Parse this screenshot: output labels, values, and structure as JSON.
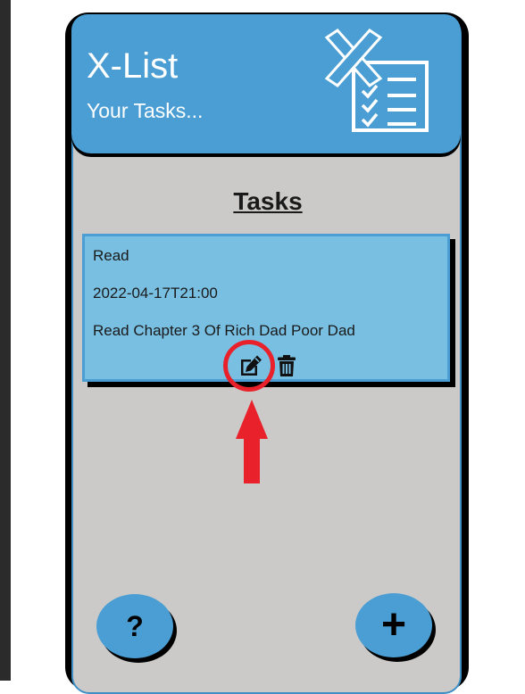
{
  "app": {
    "title": "X-List",
    "subtitle": "Your Tasks..."
  },
  "section": {
    "title": "Tasks"
  },
  "tasks": [
    {
      "title": "Read",
      "date": "2022-04-17T21:00",
      "description": "Read Chapter 3 Of Rich Dad Poor Dad"
    }
  ],
  "buttons": {
    "help_label": "?",
    "add_label": "+"
  },
  "icons": {
    "logo": "x-checklist-logo",
    "edit": "edit-icon",
    "delete": "trash-icon",
    "annotation_arrow": "arrow-up-icon"
  },
  "colors": {
    "header": "#4a9ed3",
    "card": "#78bfe2",
    "background": "#cbcac9",
    "highlight": "#e8212b"
  }
}
